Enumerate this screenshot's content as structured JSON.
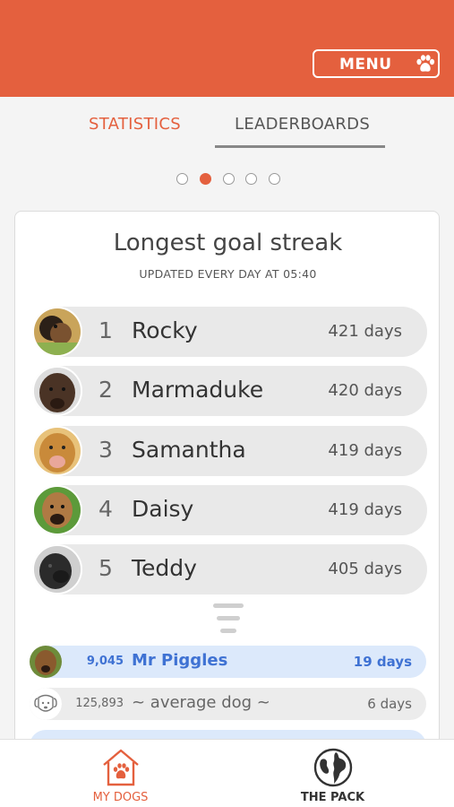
{
  "header": {
    "menu_label": "MENU",
    "menu_icon": "paw-icon",
    "accent": "#e4603e"
  },
  "tabs": [
    {
      "label": "STATISTICS",
      "active": false
    },
    {
      "label": "LEADERBOARDS",
      "active": true
    }
  ],
  "pager": {
    "count": 5,
    "active_index": 1
  },
  "leaderboard": {
    "title": "Longest goal streak",
    "subtitle": "UPDATED EVERY DAY AT 05:40",
    "top": [
      {
        "rank": "1",
        "name": "Rocky",
        "days": "421 days",
        "avatar": "dog-avatar"
      },
      {
        "rank": "2",
        "name": "Marmaduke",
        "days": "420 days",
        "avatar": "dog-avatar"
      },
      {
        "rank": "3",
        "name": "Samantha",
        "days": "419 days",
        "avatar": "dog-avatar"
      },
      {
        "rank": "4",
        "name": "Daisy",
        "days": "419 days",
        "avatar": "dog-avatar"
      },
      {
        "rank": "5",
        "name": "Teddy",
        "days": "405 days",
        "avatar": "dog-avatar"
      }
    ],
    "gap_icon": "ellipsis-gap-icon",
    "near": [
      {
        "rank": "9,045",
        "name": "Mr Piggles",
        "days": "19 days",
        "highlight": true
      },
      {
        "rank": "125,893",
        "name": "~ average dog ~",
        "days": "6 days",
        "highlight": false
      }
    ]
  },
  "bottom_nav": [
    {
      "label": "MY DOGS",
      "icon": "dog-house-icon",
      "active": true
    },
    {
      "label": "THE PACK",
      "icon": "globe-icon",
      "active": false
    }
  ]
}
